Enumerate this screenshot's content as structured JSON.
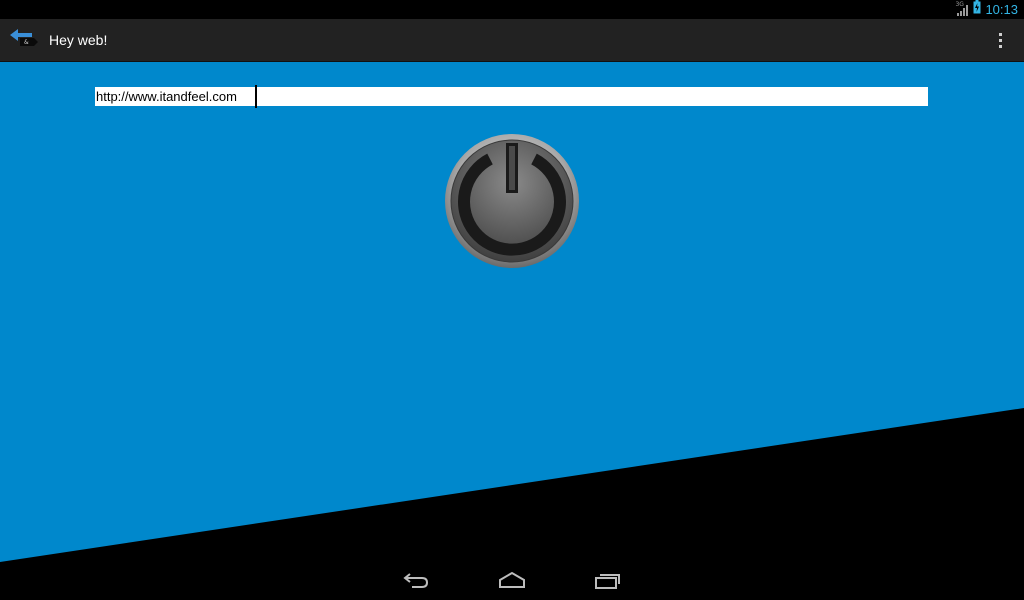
{
  "status_bar": {
    "network_label": "3G",
    "time": "10:13"
  },
  "action_bar": {
    "title": "Hey web!",
    "icons": [
      "back-arrow-icon",
      "overflow-menu-icon"
    ]
  },
  "main": {
    "url_input_value": "http://www.itandfeel.com",
    "power_button_icon": "power-icon"
  },
  "nav_bar": {
    "icons": [
      "back-icon",
      "home-icon",
      "recent-apps-icon"
    ]
  },
  "colors": {
    "background_blue": "#0088cc",
    "action_bar": "#222222",
    "status_accent": "#33b5e5",
    "nav_icons": "#9a9a9a"
  }
}
